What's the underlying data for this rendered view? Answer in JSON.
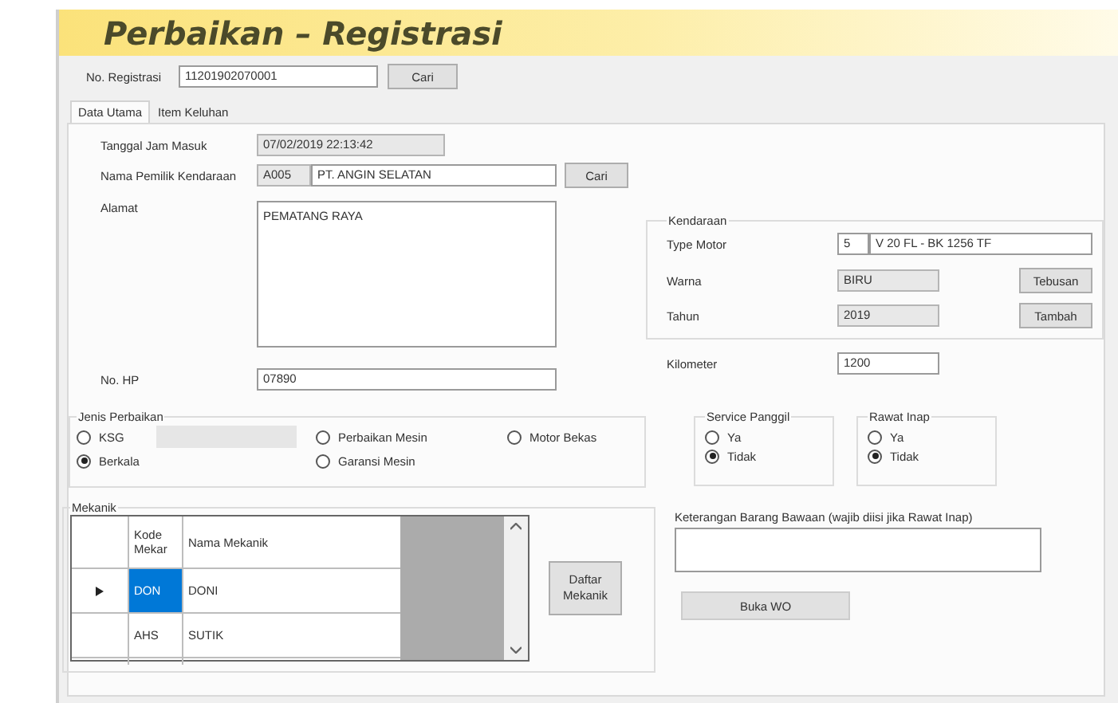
{
  "window": {
    "title": "Perbaikan – Registrasi"
  },
  "registrasi": {
    "label": "No. Registrasi",
    "value": "11201902070001",
    "button": "Cari"
  },
  "tabs": [
    {
      "label": "Data Utama",
      "selected": true
    },
    {
      "label": "Item Keluhan",
      "selected": false
    }
  ],
  "tanggal": {
    "label": "Tanggal Jam Masuk",
    "value": "07/02/2019 22:13:42"
  },
  "pemilik": {
    "label": "Nama Pemilik Kendaraan",
    "code": "A005",
    "value": "PT. ANGIN SELATAN",
    "button": "Cari"
  },
  "alamat": {
    "label": "Alamat",
    "value": "PEMATANG RAYA"
  },
  "hp": {
    "label": "No. HP",
    "value": "07890"
  },
  "kendaraan": {
    "title": "Kendaraan",
    "type_motor": {
      "label": "Type Motor",
      "code": "5",
      "value": "V 20 FL - BK 1256 TF"
    },
    "warna": {
      "label": "Warna",
      "value": "BIRU",
      "button": "Tebusan"
    },
    "tahun": {
      "label": "Tahun",
      "value": "2019",
      "button": "Tambah"
    }
  },
  "kilometer": {
    "label": "Kilometer",
    "value": "1200"
  },
  "jenis_perbaikan": {
    "title": "Jenis Perbaikan",
    "options": [
      {
        "label": "KSG",
        "selected": false,
        "field": {
          "disabled": true
        }
      },
      {
        "label": "Perbaikan Mesin",
        "selected": false
      },
      {
        "label": "Motor Bekas",
        "selected": false
      },
      {
        "label": "Berkala",
        "selected": true
      },
      {
        "label": "Garansi Mesin",
        "selected": false
      }
    ]
  },
  "service_panggil": {
    "title": "Service Panggil",
    "options": [
      {
        "label": "Ya",
        "selected": false
      },
      {
        "label": "Tidak",
        "selected": true
      }
    ]
  },
  "rawat_inap": {
    "title": "Rawat Inap",
    "options": [
      {
        "label": "Ya",
        "selected": false
      },
      {
        "label": "Tidak",
        "selected": true
      }
    ]
  },
  "mekanik": {
    "title": "Mekanik",
    "columns": [
      "Kode Mekar",
      "Nama Mekanik"
    ],
    "rows": [
      {
        "cells": [
          "DON",
          "DONI"
        ],
        "current": true,
        "selected": true
      },
      {
        "cells": [
          "AHS",
          "SUTIK"
        ],
        "current": false,
        "selected": false
      }
    ],
    "button": "Daftar Mekanik"
  },
  "keterangan": {
    "label": "Keterangan Barang Bawaan (wajib diisi jika Rawat Inap)"
  },
  "buka_wo": "Buka WO"
}
